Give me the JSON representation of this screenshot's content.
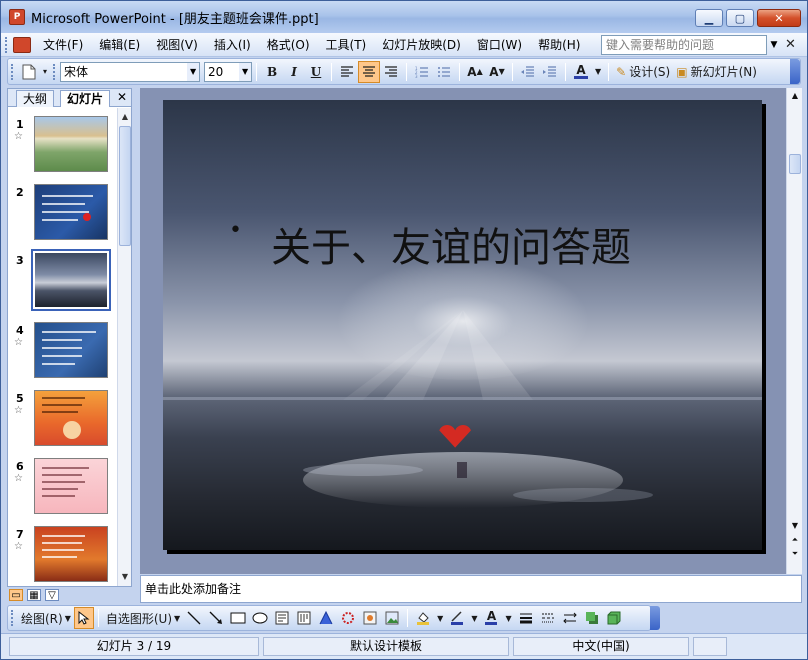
{
  "window": {
    "title": "Microsoft PowerPoint - [朋友主题班会课件.ppt]",
    "app_icon": "powerpoint-icon"
  },
  "menu": {
    "items": [
      "文件(F)",
      "编辑(E)",
      "视图(V)",
      "插入(I)",
      "格式(O)",
      "工具(T)",
      "幻灯片放映(D)",
      "窗口(W)",
      "帮助(H)"
    ],
    "help_placeholder": "键入需要帮助的问题"
  },
  "toolbar": {
    "font_name": "宋体",
    "font_size": "20",
    "bold": "B",
    "italic": "I",
    "underline": "U",
    "design_label": "设计(S)",
    "new_slide_label": "新幻灯片(N)"
  },
  "panel": {
    "tab_outline": "大纲",
    "tab_slides": "幻灯片",
    "slides": [
      {
        "num": "1",
        "theme": "collage"
      },
      {
        "num": "2",
        "theme": "blue-text-heart"
      },
      {
        "num": "3",
        "theme": "sunset-beach"
      },
      {
        "num": "4",
        "theme": "blue-text"
      },
      {
        "num": "5",
        "theme": "orange-cartoon"
      },
      {
        "num": "6",
        "theme": "pink-text"
      },
      {
        "num": "7",
        "theme": "orange-text"
      }
    ],
    "selected_slide": 3
  },
  "slide": {
    "bullet": "•",
    "title": "关于、友谊的问答题"
  },
  "notes": {
    "placeholder": "单击此处添加备注"
  },
  "drawbar": {
    "draw_label": "绘图(R)",
    "autoshapes_label": "自选图形(U)"
  },
  "status": {
    "slide_position": "幻灯片 3 / 19",
    "template": "默认设计模板",
    "language": "中文(中国)"
  },
  "colors": {
    "accent": "#3a62b8",
    "titlebar": "#a9c3ea",
    "slide_sky": "#3a4760"
  }
}
